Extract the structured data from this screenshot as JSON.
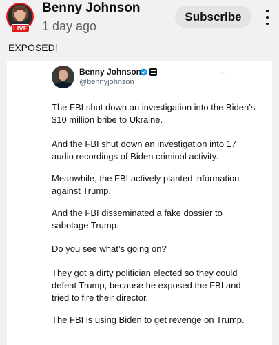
{
  "header": {
    "channel_name": "Benny Johnson",
    "post_time": "1 day ago",
    "live_label": "LIVE",
    "subscribe_label": "Subscribe",
    "more_icon": "vertical-ellipsis-icon"
  },
  "post": {
    "caption": "EXPOSED!"
  },
  "tweet": {
    "author": "Benny Johnson",
    "handle": "@bennyjohnson",
    "menu": "···",
    "paragraphs": [
      "The FBI shut down an investigation into the Biden’s $10 million bribe to Ukraine.",
      "And the FBI shut down an investigation into 17 audio recordings of Biden criminal activity.",
      "Meanwhile, the FBI actively planted information against Trump.",
      "And the FBI disseminated a fake dossier to sabotage Trump.",
      "Do you see what’s going on?",
      "They got a dirty politician elected so they could defeat Trump, because he exposed the FBI and tried to fire their director.",
      "The FBI is using Biden to get revenge on Trump."
    ]
  },
  "colors": {
    "live_red": "#e01a1a",
    "verified_blue": "#1d9bf0",
    "background": "#f1f1f1"
  }
}
